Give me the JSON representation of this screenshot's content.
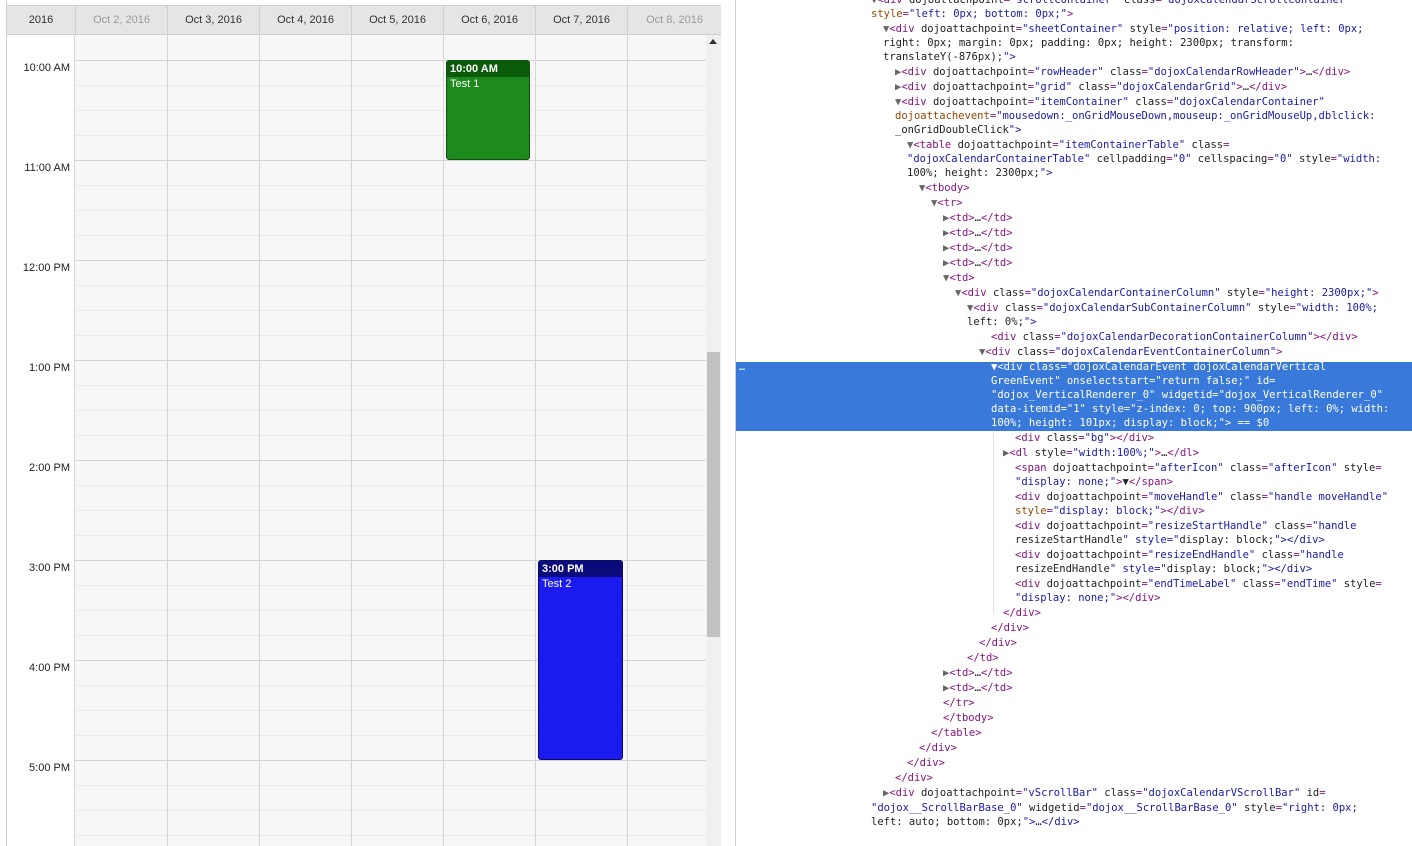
{
  "calendar": {
    "headers": [
      "2016",
      "Oct 2, 2016",
      "Oct 3, 2016",
      "Oct 4, 2016",
      "Oct 5, 2016",
      "Oct 6, 2016",
      "Oct 7, 2016",
      "Oct 8, 2016"
    ],
    "hours": [
      "10:00 AM",
      "11:00 AM",
      "12:00 PM",
      "1:00 PM",
      "2:00 PM",
      "3:00 PM",
      "4:00 PM",
      "5:00 PM"
    ],
    "events": [
      {
        "time": "10:00 AM",
        "title": "Test 1",
        "color": "#1e8a1e",
        "header_color": "#0b5b0b",
        "border": "#0f4f0f"
      },
      {
        "time": "3:00 PM",
        "title": "Test 2",
        "color": "#1b1bf0",
        "header_color": "#0a0a7a",
        "border": "#0b0b6b"
      }
    ]
  },
  "devtools": {
    "selected_dots": "…",
    "lines": [
      "▼<div dojoattachpoint=\"scrollContainer\" class=\"dojoxCalendarScrollContainer\"",
      "style=\"left: 0px; bottom: 0px;\">",
      "▼<div dojoattachpoint=\"sheetContainer\" style=\"position: relative; left: 0px;",
      "right: 0px; margin: 0px; padding: 0px; height: 2300px; transform:",
      "translateY(-876px);\">",
      "▶<div dojoattachpoint=\"rowHeader\" class=\"dojoxCalendarRowHeader\">…</div>",
      "▶<div dojoattachpoint=\"grid\" class=\"dojoxCalendarGrid\">…</div>",
      "▼<div dojoattachpoint=\"itemContainer\" class=\"dojoxCalendarContainer\"",
      "dojoattachevent=\"mousedown:_onGridMouseDown,mouseup:_onGridMouseUp,dblclick:",
      "_onGridDoubleClick\">",
      "▼<table dojoattachpoint=\"itemContainerTable\" class=",
      "\"dojoxCalendarContainerTable\" cellpadding=\"0\" cellspacing=\"0\" style=\"width:",
      "100%; height: 2300px;\">",
      "▼<tbody>",
      "▼<tr>",
      "▶<td>…</td>",
      "▶<td>…</td>",
      "▶<td>…</td>",
      "▶<td>…</td>",
      "▼<td>",
      "▼<div class=\"dojoxCalendarContainerColumn\" style=\"height: 2300px;\">",
      "▼<div class=\"dojoxCalendarSubContainerColumn\" style=\"width: 100%;",
      "left: 0%;\">",
      "<div class=\"dojoxCalendarDecorationContainerColumn\"></div>",
      "▼<div class=\"dojoxCalendarEventContainerColumn\">",
      "▼<div class=\"dojoxCalendarEvent dojoxCalendarVertical",
      "GreenEvent\" onselectstart=\"return false;\" id=",
      "\"dojox_VerticalRenderer_0\" widgetid=\"dojox_VerticalRenderer_0\"",
      "data-itemid=\"1\" style=\"z-index: 0; top: 900px; left: 0%; width:",
      "100%; height: 101px; display: block;\"> == $0",
      "<div class=\"bg\"></div>",
      "▶<dl style=\"width:100%;\">…</dl>",
      "<span dojoattachpoint=\"afterIcon\" class=\"afterIcon\" style=",
      "\"display: none;\">▼</span>",
      "<div dojoattachpoint=\"moveHandle\" class=\"handle moveHandle\"",
      "style=\"display: block;\"></div>",
      "<div dojoattachpoint=\"resizeStartHandle\" class=\"handle",
      "resizeStartHandle\" style=\"display: block;\"></div>",
      "<div dojoattachpoint=\"resizeEndHandle\" class=\"handle",
      "resizeEndHandle\" style=\"display: block;\"></div>",
      "<div dojoattachpoint=\"endTimeLabel\" class=\"endTime\" style=",
      "\"display: none;\"></div>",
      "</div>",
      "</div>",
      "</div>",
      "</td>",
      "▶<td>…</td>",
      "▶<td>…</td>",
      "</tr>",
      "</tbody>",
      "</table>",
      "</div>",
      "</div>",
      "</div>",
      "▶<div dojoattachpoint=\"vScrollBar\" class=\"dojoxCalendarVScrollBar\" id=",
      "\"dojox__ScrollBarBase_0\" widgetid=\"dojox__ScrollBarBase_0\" style=\"right: 0px;",
      "left: auto; bottom: 0px;\">…</div>"
    ]
  }
}
